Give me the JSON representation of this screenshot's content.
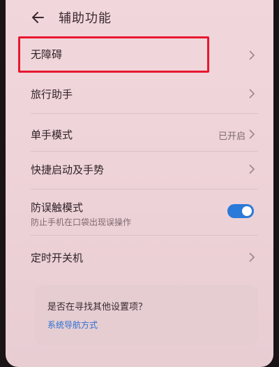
{
  "header": {
    "title": "辅助功能",
    "back_icon": "back-arrow-icon"
  },
  "settings": {
    "accessibility": {
      "label": "无障碍"
    },
    "travel_assistant": {
      "label": "旅行助手"
    },
    "one_hand_mode": {
      "label": "单手模式",
      "status": "已开启"
    },
    "quick_launch": {
      "label": "快捷启动及手势"
    },
    "accidental_touch": {
      "label": "防误触模式",
      "description": "防止手机在口袋出现误操作",
      "enabled": true
    },
    "scheduled_power": {
      "label": "定时开关机"
    }
  },
  "suggestion_card": {
    "question": "是否在寻找其他设置项？",
    "link": "系统导航方式"
  },
  "colors": {
    "highlight": "#e8172f",
    "toggle_on": "#2b79d9",
    "link": "#2f6fd0",
    "background": "#f1d7dc"
  }
}
